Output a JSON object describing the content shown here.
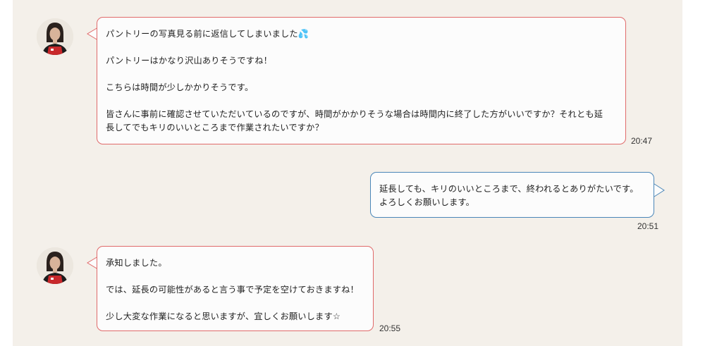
{
  "messages": [
    {
      "sender": "staff",
      "lines": [
        "パントリーの写真見る前に返信してしまいました💦",
        "",
        "パントリーはかなり沢山ありそうですね！",
        "",
        "こちらは時間が少しかかりそうです。",
        "",
        "皆さんに事前に確認させていただいているのですが、時間がかかりそうな場合は時間内に終了した方がいいですか？それとも延",
        "長してでもキリのいいところまで作業されたいですか？"
      ],
      "time": "20:47"
    },
    {
      "sender": "customer",
      "lines": [
        "延長しても、キリのいいところまで、終われるとありがたいです。",
        "よろしくお願いします。"
      ],
      "time": "20:51"
    },
    {
      "sender": "staff",
      "lines": [
        "承知しました。",
        "",
        "では、延長の可能性があると言う事で予定を空けておきますね！",
        "",
        "少し大変な作業になると思いますが、宜しくお願いします☆"
      ],
      "time": "20:55"
    }
  ],
  "colors": {
    "background": "#f4f0ea",
    "staff_border": "#e06a6a",
    "customer_border": "#4a86b8",
    "bubble_fill": "#fcfcfc"
  },
  "icons": {
    "avatar": "staff-avatar-icon"
  }
}
